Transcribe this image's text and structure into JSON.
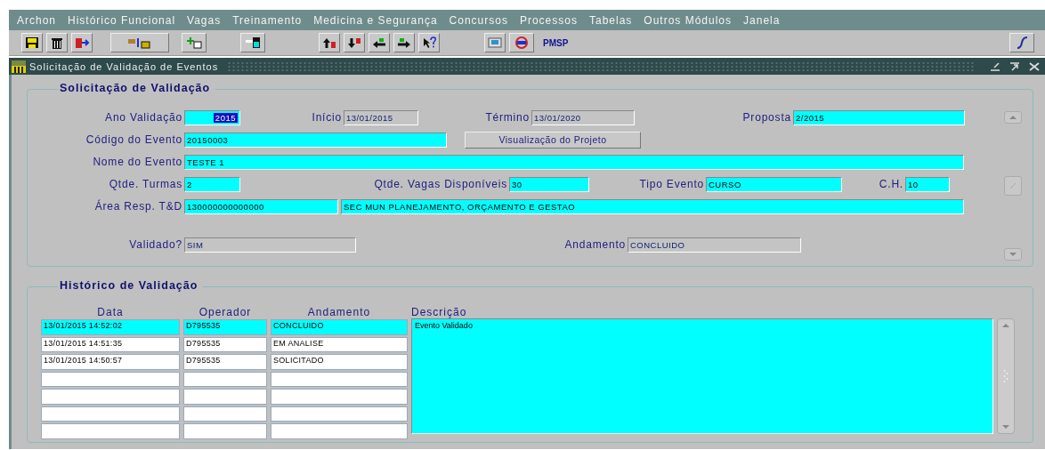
{
  "menu": [
    {
      "label": "Archon",
      "selected": false
    },
    {
      "label": "Histórico Funcional",
      "selected": false
    },
    {
      "label": "Vagas",
      "selected": false
    },
    {
      "label": "Treinamento",
      "selected": false
    },
    {
      "label": "Medicina e Segurança",
      "selected": false
    },
    {
      "label": "Concursos",
      "selected": false
    },
    {
      "label": "Processos",
      "selected": false
    },
    {
      "label": "Tabelas",
      "selected": false
    },
    {
      "label": "Outros Módulos",
      "selected": false
    },
    {
      "label": "Janela",
      "selected": false
    }
  ],
  "toolbar": {
    "brand": "PMSP"
  },
  "window": {
    "title": "Solicitação de Validação de Eventos"
  },
  "request": {
    "title": "Solicitação de Validação",
    "ano": {
      "label": "Ano Validação",
      "value": "2015",
      "readonly": false,
      "selected": true
    },
    "inicio": {
      "label": "Início",
      "value": "13/01/2015",
      "readonly": true
    },
    "termino": {
      "label": "Término",
      "value": "13/01/2020",
      "readonly": true
    },
    "proposta": {
      "label": "Proposta",
      "value": "2/2015",
      "readonly": false
    },
    "codigo": {
      "label": "Código do Evento",
      "value": "20150003",
      "readonly": false
    },
    "project_button": "Visualização do Projeto",
    "nome": {
      "label": "Nome do Evento",
      "value": "TESTE 1",
      "readonly": false
    },
    "turmas": {
      "label": "Qtde. Turmas",
      "value": "2",
      "readonly": false
    },
    "vagas": {
      "label": "Qtde. Vagas Disponíveis",
      "value": "30",
      "readonly": false
    },
    "tipo": {
      "label": "Tipo Evento",
      "value": "CURSO",
      "readonly": false
    },
    "ch": {
      "label": "C.H.",
      "value": "10",
      "readonly": false
    },
    "area": {
      "label": "Área Resp. T&D",
      "value": "130000000000000",
      "readonly": false
    },
    "area_nome": {
      "value": "SEC MUN PLANEJAMENTO, ORÇAMENTO E GESTAO",
      "readonly": false
    },
    "validado": {
      "label": "Validado?",
      "value": "SIM",
      "readonly": true
    },
    "andamento": {
      "label": "Andamento",
      "value": "CONCLUIDO",
      "readonly": true
    }
  },
  "history": {
    "title": "Histórico de Validação",
    "columns": [
      "Data",
      "Operador",
      "Andamento",
      "Descrição"
    ],
    "rows": [
      {
        "data": "13/01/2015 14:52:02",
        "operador": "D795535",
        "andamento": "CONCLUIDO",
        "selected": true
      },
      {
        "data": "13/01/2015 14:51:35",
        "operador": "D795535",
        "andamento": "EM ANALISE",
        "selected": false
      },
      {
        "data": "13/01/2015 14:50:57",
        "operador": "D795535",
        "andamento": "SOLICITADO",
        "selected": false
      }
    ],
    "descricao": "Evento Validado"
  }
}
